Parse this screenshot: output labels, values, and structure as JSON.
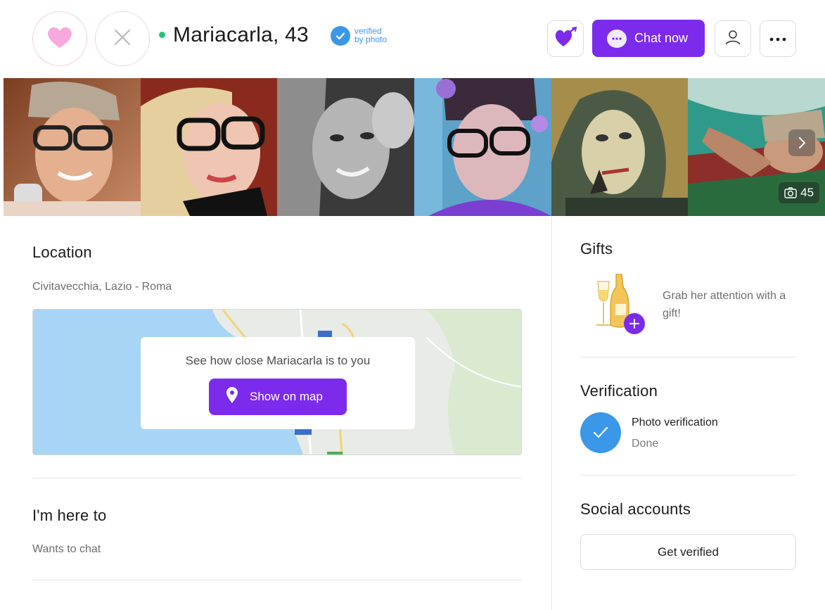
{
  "header": {
    "name_age": "Mariacarla, 43",
    "verified_line1": "verified",
    "verified_line2": "by photo",
    "chat_button": "Chat now",
    "online_color": "#25c27b",
    "accent_color": "#7c2bec",
    "verified_color": "#3b97e8",
    "icons": [
      "heart-icon",
      "close-icon",
      "verified-check-icon",
      "heart-gift-icon",
      "chat-bubble-icon",
      "user-icon",
      "more-dots-icon"
    ]
  },
  "photos": {
    "count_label": "45",
    "items": [
      "photo-1",
      "photo-2",
      "photo-3",
      "photo-4",
      "photo-5",
      "photo-6"
    ]
  },
  "location": {
    "title": "Location",
    "place": "Civitavecchia, Lazio - Roma",
    "map_prompt": "See how close Mariacarla is to you",
    "map_button": "Show on map"
  },
  "intent": {
    "title": "I'm here to",
    "value": "Wants to chat"
  },
  "gifts": {
    "title": "Gifts",
    "text": "Grab her attention with a gift!"
  },
  "verification": {
    "title": "Verification",
    "item_name": "Photo verification",
    "item_status": "Done"
  },
  "social": {
    "title": "Social accounts",
    "button": "Get verified"
  }
}
